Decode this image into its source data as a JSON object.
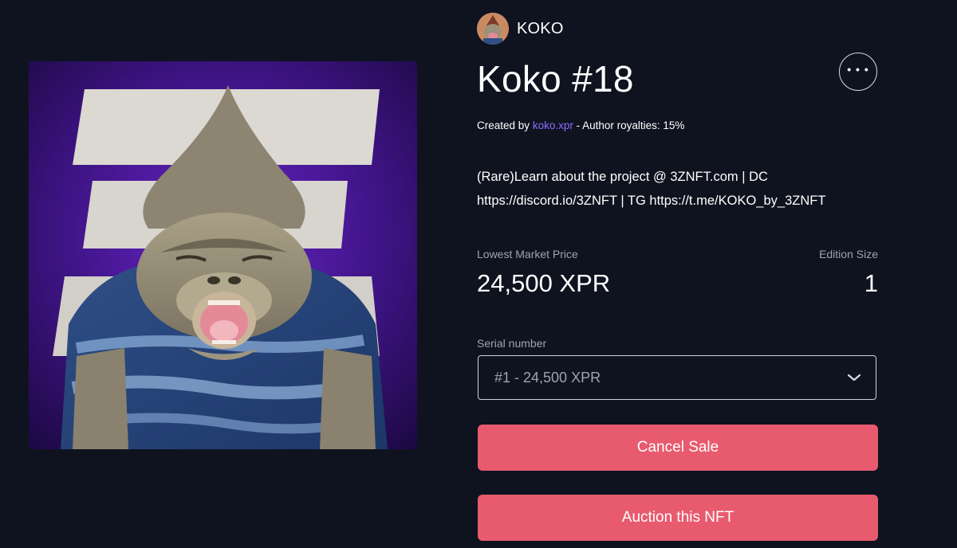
{
  "collection": {
    "name": "KOKO",
    "avatar_icon": "koko-avatar"
  },
  "nft": {
    "title": "Koko #18",
    "created_by_prefix": "Created by",
    "author": "koko.xpr",
    "royalties_text": "- Author royalties: 15%",
    "description_line1": "(Rare)Learn about the project @ 3ZNFT.com | DC",
    "description_line2": "https://discord.io/3ZNFT | TG https://t.me/KOKO_by_3ZNFT"
  },
  "market": {
    "lowest_price_label": "Lowest Market Price",
    "lowest_price_value": "24,500 XPR",
    "edition_size_label": "Edition Size",
    "edition_size_value": "1"
  },
  "serial": {
    "label": "Serial number",
    "selected": "#1 - 24,500 XPR"
  },
  "actions": {
    "more_icon": "ellipsis-icon",
    "cancel_sale": "Cancel Sale",
    "auction": "Auction this NFT"
  },
  "colors": {
    "background": "#0f1320",
    "accent_button": "#e85a6e",
    "author_link": "#8e6cff",
    "muted_text": "#9ea3b0"
  }
}
